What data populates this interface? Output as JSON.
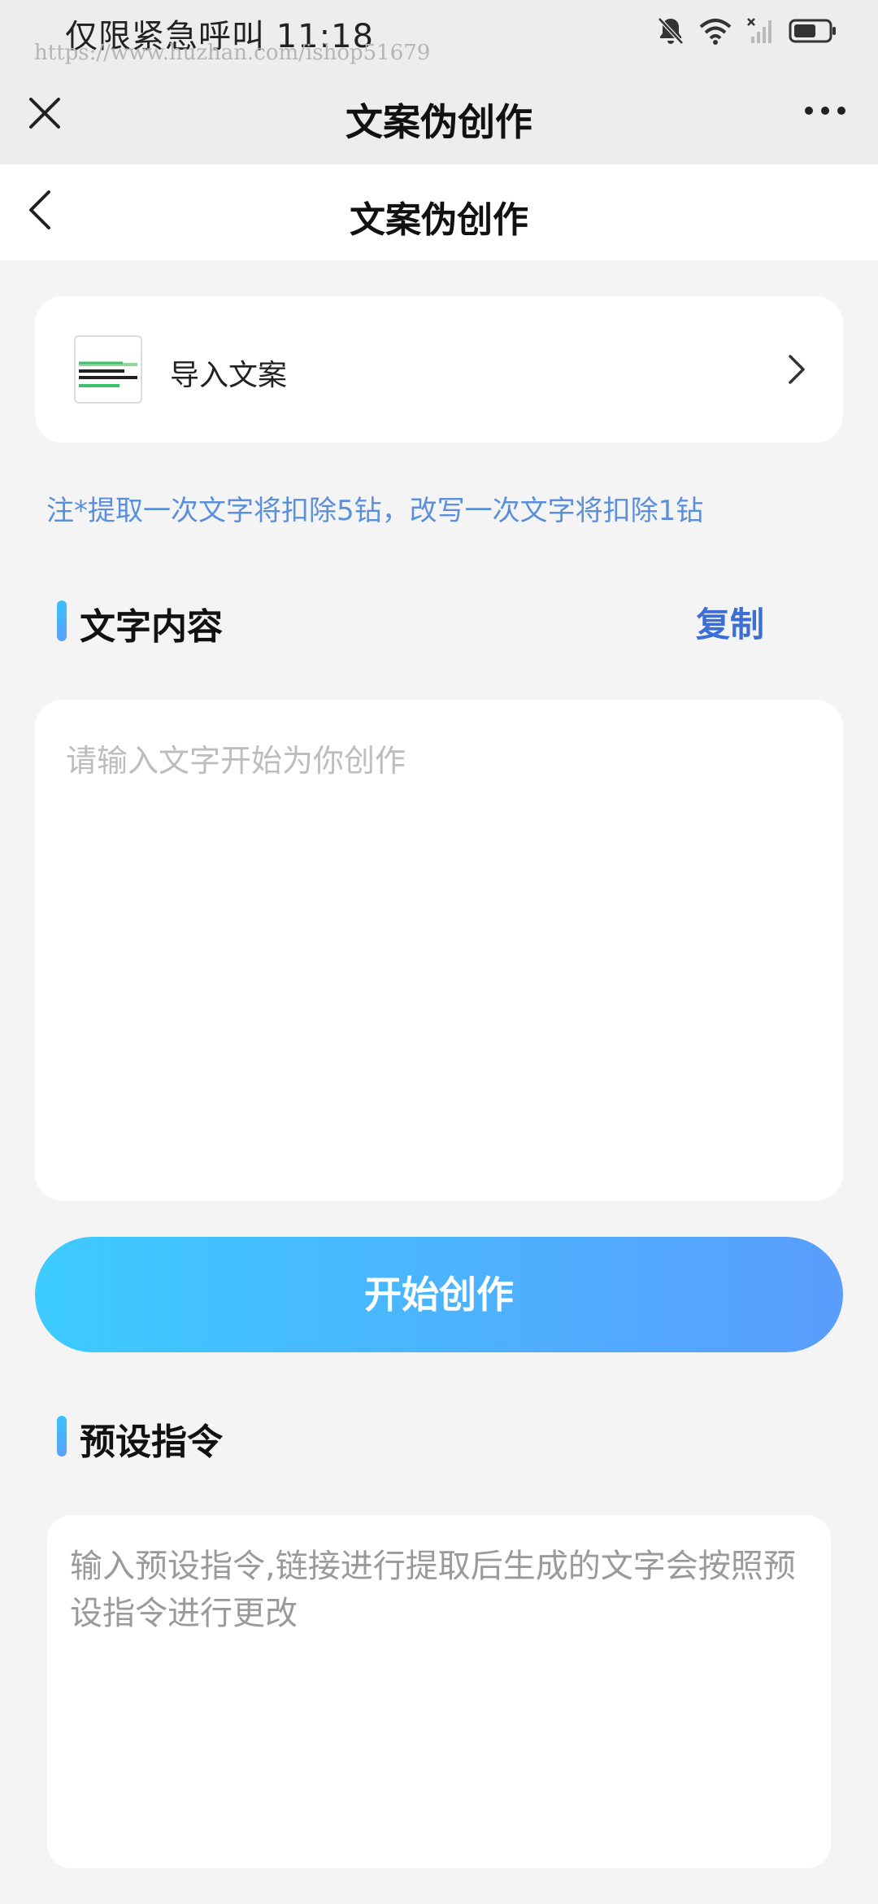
{
  "status_bar": {
    "text": "仅限紧急呼叫 11:18",
    "watermark": "https://www.huzhan.com/ishop51679"
  },
  "wx_nav": {
    "title": "文案伪创作"
  },
  "page_header": {
    "title": "文案伪创作"
  },
  "import_card": {
    "label": "导入文案"
  },
  "notice": "注*提取一次文字将扣除5钻，改写一次文字将扣除1钻",
  "text_section": {
    "title": "文字内容",
    "copy_label": "复制",
    "placeholder": "请输入文字开始为你创作"
  },
  "start_button": "开始创作",
  "command_section": {
    "title": "预设指令",
    "placeholder": "输入预设指令,链接进行提取后生成的文字会按照预设指令进行更改"
  },
  "colors": {
    "accent_blue": "#3b6fd6",
    "notice_blue": "#5a8fdc",
    "gradient_start": "#3ccbff",
    "gradient_end": "#5a9dfd"
  }
}
